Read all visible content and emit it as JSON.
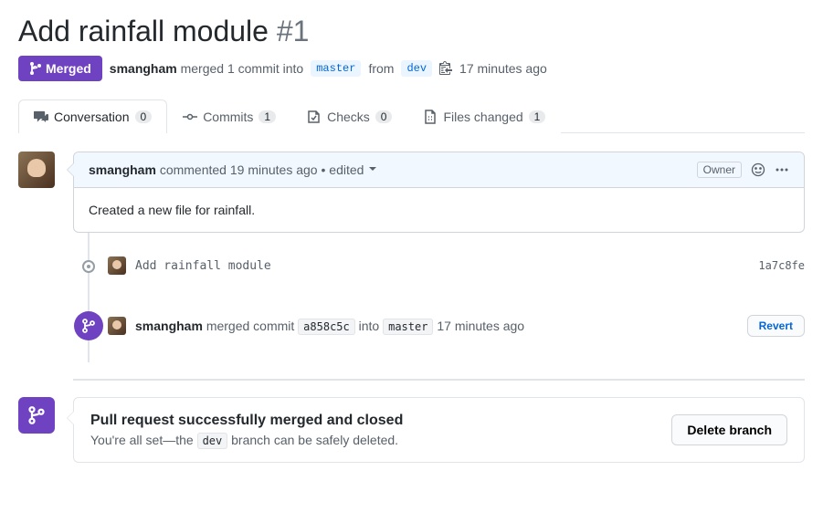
{
  "title": "Add rainfall module",
  "number": "#1",
  "state": {
    "label": "Merged"
  },
  "meta": {
    "actor": "smangham",
    "action": "merged 1 commit into",
    "target_branch": "master",
    "from_word": "from",
    "source_branch": "dev",
    "time": "17 minutes ago"
  },
  "tabs": {
    "conversation": {
      "label": "Conversation",
      "count": "0"
    },
    "commits": {
      "label": "Commits",
      "count": "1"
    },
    "checks": {
      "label": "Checks",
      "count": "0"
    },
    "files": {
      "label": "Files changed",
      "count": "1"
    }
  },
  "comment": {
    "author": "smangham",
    "action": "commented",
    "time": "19 minutes ago",
    "edited_sep": "•",
    "edited": "edited",
    "owner_label": "Owner",
    "body": "Created a new file for rainfall."
  },
  "commit": {
    "message": "Add rainfall module",
    "sha": "1a7c8fe"
  },
  "merge_event": {
    "actor": "smangham",
    "text1": "merged commit",
    "commit_sha": "a858c5c",
    "text2": "into",
    "branch": "master",
    "time": "17 minutes ago",
    "revert_label": "Revert"
  },
  "closed": {
    "title": "Pull request successfully merged and closed",
    "sub_before": "You're all set—the ",
    "branch": "dev",
    "sub_after": " branch can be safely deleted.",
    "delete_label": "Delete branch"
  }
}
